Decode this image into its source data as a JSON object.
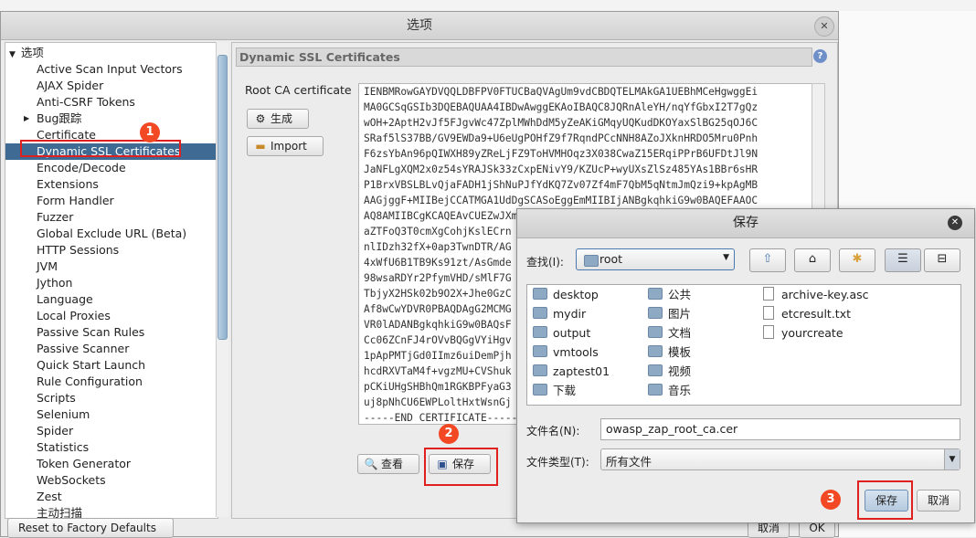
{
  "dialog": {
    "title": "选项"
  },
  "tree": {
    "root_label": "选项",
    "items": [
      {
        "label": "Active Scan Input Vectors"
      },
      {
        "label": "AJAX Spider"
      },
      {
        "label": "Anti-CSRF Tokens"
      },
      {
        "label": "Bug跟踪",
        "expandable": true
      },
      {
        "label": "Certificate"
      },
      {
        "label": "Dynamic SSL Certificates",
        "selected": true
      },
      {
        "label": "Encode/Decode"
      },
      {
        "label": "Extensions"
      },
      {
        "label": "Form Handler"
      },
      {
        "label": "Fuzzer"
      },
      {
        "label": "Global Exclude URL (Beta)"
      },
      {
        "label": "HTTP Sessions"
      },
      {
        "label": "JVM"
      },
      {
        "label": "Jython"
      },
      {
        "label": "Language"
      },
      {
        "label": "Local Proxies"
      },
      {
        "label": "Passive Scan Rules"
      },
      {
        "label": "Passive Scanner"
      },
      {
        "label": "Quick Start Launch"
      },
      {
        "label": "Rule Configuration"
      },
      {
        "label": "Scripts"
      },
      {
        "label": "Selenium"
      },
      {
        "label": "Spider"
      },
      {
        "label": "Statistics"
      },
      {
        "label": "Token Generator"
      },
      {
        "label": "WebSockets"
      },
      {
        "label": "Zest"
      },
      {
        "label": "主动扫描"
      }
    ]
  },
  "panel": {
    "header": "Dynamic SSL Certificates",
    "root_ca_label": "Root CA certificate",
    "generate_label": "生成",
    "import_label": "Import",
    "view_label": "查看",
    "save_label": "保存",
    "cert_lines": [
      "IENBMRowGAYDVQQLDBFPV0FTUCBaQVAgUm9vdCBDQTELMAkGA1UEBhMCeHgwggEi",
      "MA0GCSqGSIb3DQEBAQUAA4IBDwAwggEKAoIBAQC8JQRnAleYH/nqYfGbxI2T7gQz",
      "wOH+2AptH2vJf5FJgvWc47ZplMWhDdM5yZeAKiGMqyUQKudDKOYaxSlBG25qOJ6C",
      "SRaf5lS37BB/GV9EWDa9+U6eUgPOHfZ9f7RqndPCcNNH8AZoJXknHRDO5Mru0Pnh",
      "F6zsYbAn96pQIWXH89yZReLjFZ9ToHVMHOqz3X038CwaZ15ERqiPPrB6UFDtJl9N",
      "JaNFLgXQM2x0z54sYRAJSk33zCxpENivY9/KZUcP+wyUXsZlSz485YAs1BBr6sHR",
      "P1BrxVBSLBLvQjaFADH1jShNuPJfYdKQ7Zv07Zf4mF7QbM5qNtmJmQzi9+kpAgMB",
      "AAGjggF+MIIBejCCATMGA1UdDgSCASoEggEmMIIBIjANBgkqhkiG9w0BAQEFAAOC",
      "AQ8AMIIBCgKCAQEAvCUEZwJXm",
      "aZTFoQ3T0cmXgCohjKslECrn",
      "nlIDzh32fX+0ap3TwnDTR/AG",
      "4xWfU6B1TB9Ks91zt/AsGmde",
      "98wsaRDYr2PfymVHD/sMlF7G",
      "TbjyX2HSk02b9O2X+Jhe0GzC",
      "Af8wCwYDVR0PBAQDAgG2MCMG",
      "VR0lADANBgkqhkiG9w0BAQsF",
      "Cc06ZCnFJ4rOVvBQGgVYiHgv",
      "1pApPMTjGd0IImz6uiDemPjh",
      "hcdRXVTaM4f+vgzMU+CVShuk",
      "pCKiUHgSHBhQm1RGKBPFyaG3",
      "uj8pNhCU6EWPLoltHxtWsnGj",
      "-----END CERTIFICATE-----"
    ]
  },
  "footer": {
    "reset_label": "Reset to Factory Defaults",
    "cancel_label": "取消",
    "ok_label": "OK"
  },
  "save_dialog": {
    "title": "保存",
    "look_in_label": "查找(I):",
    "look_in_value": "root",
    "files": [
      {
        "name": "desktop",
        "type": "folder"
      },
      {
        "name": "mydir",
        "type": "folder"
      },
      {
        "name": "output",
        "type": "folder"
      },
      {
        "name": "vmtools",
        "type": "folder"
      },
      {
        "name": "zaptest01",
        "type": "folder"
      },
      {
        "name": "下载",
        "type": "folder"
      },
      {
        "name": "公共",
        "type": "folder"
      },
      {
        "name": "图片",
        "type": "folder"
      },
      {
        "name": "文档",
        "type": "folder"
      },
      {
        "name": "模板",
        "type": "folder"
      },
      {
        "name": "视频",
        "type": "folder"
      },
      {
        "name": "音乐",
        "type": "folder"
      },
      {
        "name": "archive-key.asc",
        "type": "file"
      },
      {
        "name": "etcresult.txt",
        "type": "file"
      },
      {
        "name": "yourcreate",
        "type": "file"
      }
    ],
    "filename_label": "文件名(N):",
    "filename_value": "owasp_zap_root_ca.cer",
    "filetype_label": "文件类型(T):",
    "filetype_value": "所有文件",
    "save_button": "保存",
    "cancel_button": "取消"
  },
  "annotations": {
    "step1": "1",
    "step2": "2",
    "step3": "3"
  },
  "colors": {
    "selection": "#3e6a93",
    "highlight_red": "#e0201e",
    "badge": "#f24824"
  }
}
